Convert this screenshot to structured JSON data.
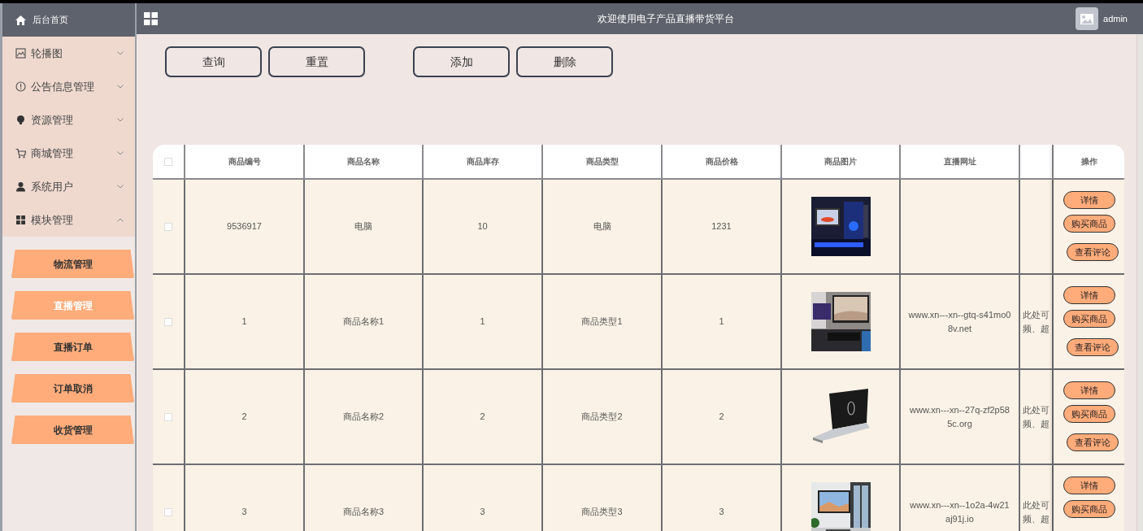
{
  "header": {
    "title": "欢迎使用电子产品直播带货平台",
    "user": "admin"
  },
  "sidebar": {
    "home": "后台首页",
    "menu": [
      {
        "label": "轮播图",
        "expanded": false
      },
      {
        "label": "公告信息管理",
        "expanded": false
      },
      {
        "label": "资源管理",
        "expanded": false
      },
      {
        "label": "商城管理",
        "expanded": false
      },
      {
        "label": "系统用户",
        "expanded": false
      },
      {
        "label": "模块管理",
        "expanded": true,
        "children": [
          {
            "label": "物流管理",
            "selected": false
          },
          {
            "label": "直播管理",
            "selected": true
          },
          {
            "label": "直播订单",
            "selected": false
          },
          {
            "label": "订单取消",
            "selected": false
          },
          {
            "label": "收货管理",
            "selected": false
          }
        ]
      }
    ]
  },
  "search_buttons": [
    {
      "label": "查询"
    },
    {
      "label": "重置"
    }
  ],
  "action_buttons": [
    {
      "label": "添加"
    },
    {
      "label": "删除"
    }
  ],
  "table": {
    "select_all": {
      "checked": false
    },
    "columns": [
      "商品编号",
      "商品名称",
      "商品库存",
      "商品类型",
      "商品价格",
      "商品图片",
      "直播网址"
    ],
    "actions_label": "操作",
    "rows": [
      {
        "checked": false,
        "id": "9536917",
        "name": "电脑",
        "stock": "10",
        "type": "电脑",
        "price": "1231",
        "picture": {
          "kind": "picture"
        },
        "actions": [
          "详情",
          "购买商品",
          "查看评论"
        ]
      },
      {
        "checked": false,
        "id": "1",
        "name": "商品名称1",
        "stock": "1",
        "type": "商品类型1",
        "price": "1",
        "picture": {
          "kind": "picture"
        },
        "url": "www.xn---xn--gtq-s41mo08v.net",
        "column_9": "此处可频、超",
        "actions": [
          "详情",
          "购买商品",
          "查看评论"
        ]
      },
      {
        "checked": false,
        "id": "2",
        "name": "商品名称2",
        "stock": "2",
        "type": "商品类型2",
        "price": "2",
        "picture": {
          "kind": "picture"
        },
        "url": "www.xn---xn--27q-zf2p585c.org",
        "column_9": "此处可频、超",
        "actions": [
          "详情",
          "购买商品",
          "查看评论"
        ]
      },
      {
        "checked": false,
        "id": "3",
        "name": "商品名称3",
        "stock": "3",
        "type": "商品类型3",
        "price": "3",
        "picture": {
          "kind": "picture"
        },
        "url": "www.xn---xn--1o2a-4w21aj91j.io",
        "column_9": "此处可频、超",
        "actions": [
          "详情",
          "购买商品"
        ]
      }
    ]
  }
}
